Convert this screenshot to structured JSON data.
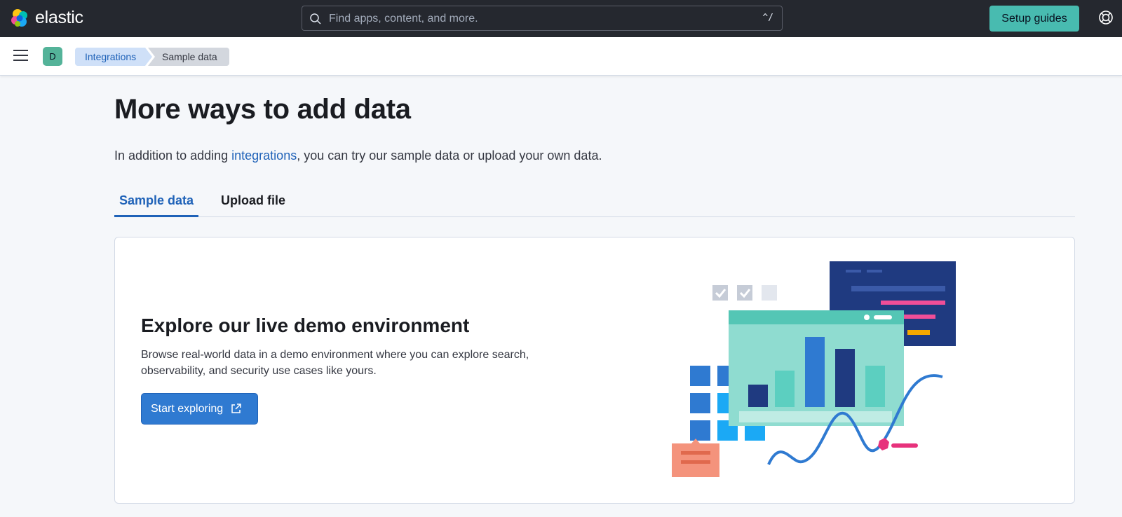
{
  "header": {
    "brand": "elastic",
    "search_placeholder": "Find apps, content, and more.",
    "search_shortcut": "^/",
    "setup_label": "Setup guides"
  },
  "breadcrumbs": {
    "space_initial": "D",
    "items": [
      {
        "label": "Integrations"
      },
      {
        "label": "Sample data"
      }
    ]
  },
  "main": {
    "title": "More ways to add data",
    "intro_before": "In addition to adding ",
    "intro_link": "integrations",
    "intro_after": ", you can try our sample data or upload your own data.",
    "tabs": [
      {
        "label": "Sample data",
        "selected": true
      },
      {
        "label": "Upload file",
        "selected": false
      }
    ],
    "panel": {
      "title": "Explore our live demo environment",
      "description": "Browse real-world data in a demo environment where you can explore search, observability, and security use cases like yours.",
      "button_label": "Start exploring"
    }
  },
  "colors": {
    "header_bg": "#25282f",
    "accent": "#48bbb0",
    "link": "#1f62b8",
    "primary_button": "#2f7ad1"
  }
}
